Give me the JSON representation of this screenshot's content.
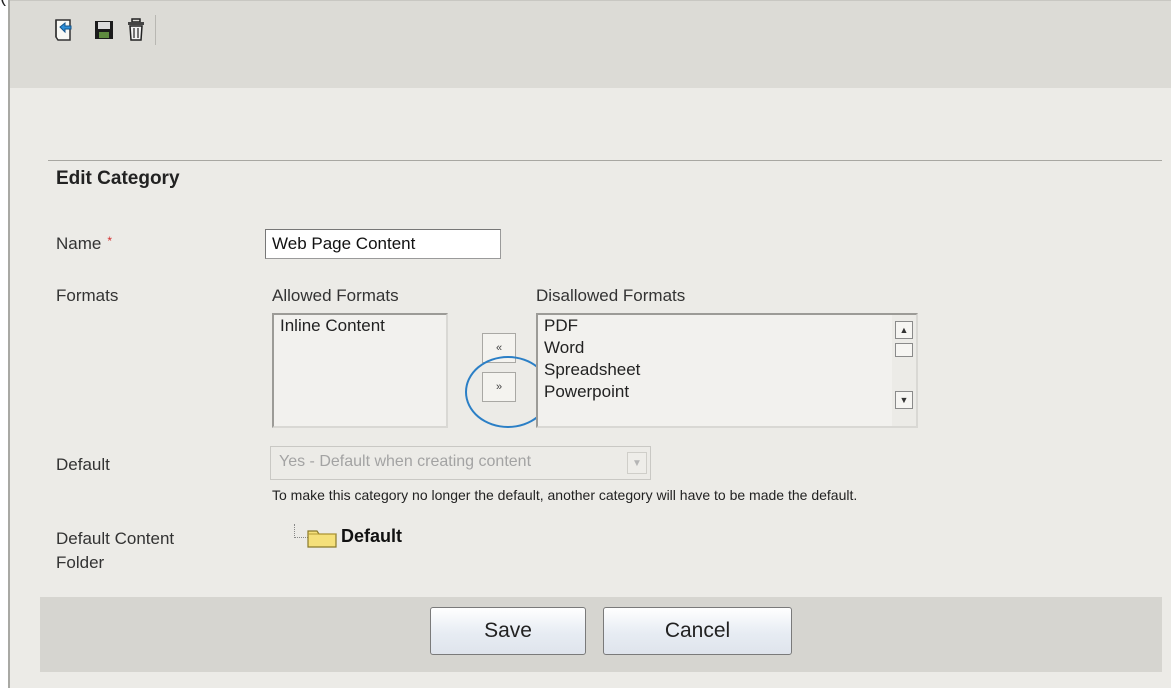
{
  "corner_text": "(",
  "toolbar": {
    "buttons": [
      {
        "icon": "back-icon"
      },
      {
        "icon": "save-icon"
      },
      {
        "icon": "delete-icon"
      }
    ]
  },
  "form": {
    "title": "Edit Category",
    "name": {
      "label": "Name",
      "required_marker": "*",
      "value": "Web Page Content"
    },
    "formats": {
      "label": "Formats",
      "allowed_heading": "Allowed Formats",
      "disallowed_heading": "Disallowed Formats",
      "allowed": [
        "Inline Content"
      ],
      "disallowed": [
        "PDF",
        "Word",
        "Spreadsheet",
        "Powerpoint"
      ],
      "move_left_label": "«",
      "move_right_label": "»"
    },
    "default": {
      "label": "Default",
      "selected": "Yes - Default when creating content",
      "help": "To make this category no longer the default, another category will have to be made the default."
    },
    "content_folder": {
      "label_line1": "Default Content",
      "label_line2": "Folder",
      "folder_name": "Default"
    }
  },
  "footer": {
    "save_label": "Save",
    "cancel_label": "Cancel"
  },
  "colors": {
    "highlight": "#2b7fc6",
    "required": "#d32f2f",
    "folder": "#f5e07a"
  }
}
